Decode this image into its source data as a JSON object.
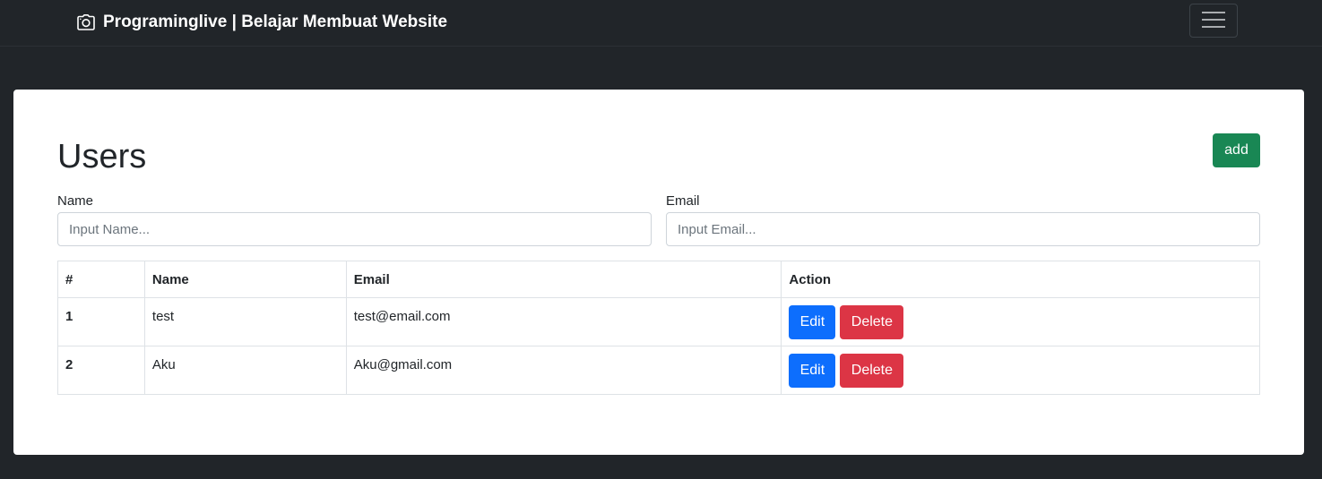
{
  "navbar": {
    "brand_icon": "camera-icon",
    "brand": "Programinglive | Belajar Membuat Website",
    "toggler_icon": "hamburger-icon"
  },
  "page": {
    "title": "Users",
    "add_label": "add"
  },
  "form": {
    "name_label": "Name",
    "name_placeholder": "Input Name...",
    "name_value": "",
    "email_label": "Email",
    "email_placeholder": "Input Email...",
    "email_value": ""
  },
  "table": {
    "headers": [
      "#",
      "Name",
      "Email",
      "Action"
    ],
    "rows": [
      {
        "id": "1",
        "name": "test",
        "email": "test@email.com",
        "edit_label": "Edit",
        "delete_label": "Delete"
      },
      {
        "id": "2",
        "name": "Aku",
        "email": "Aku@gmail.com",
        "edit_label": "Edit",
        "delete_label": "Delete"
      }
    ]
  },
  "colors": {
    "navbar_bg": "#212529",
    "add_button": "#198754",
    "edit_button": "#0d6efd",
    "delete_button": "#dc3545"
  }
}
